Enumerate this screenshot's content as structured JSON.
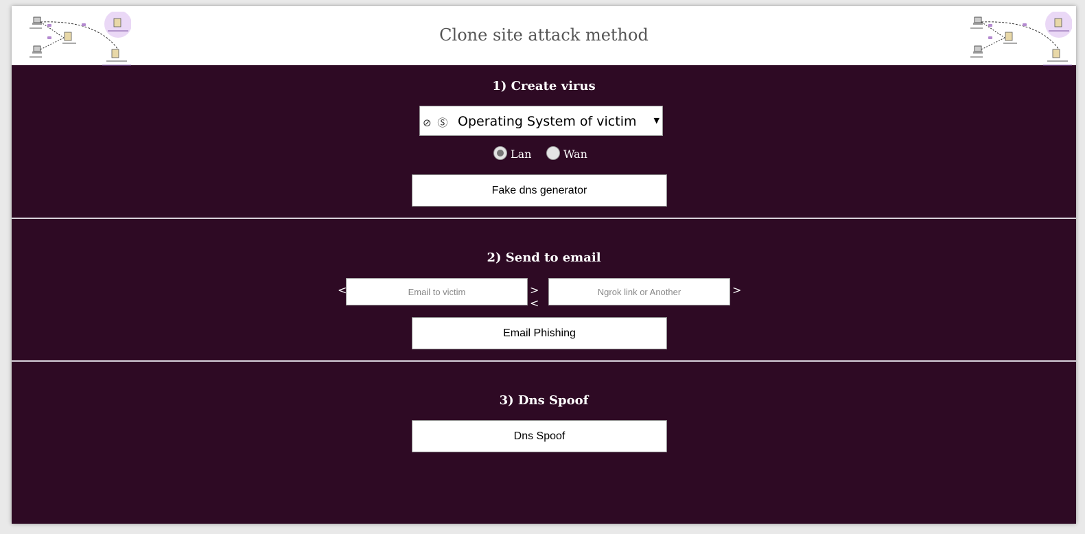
{
  "header": {
    "title": "Clone site attack method"
  },
  "section1": {
    "title": "1) Create virus",
    "os_select": {
      "icons": "⊘ Ⓢ",
      "value": "Operating System of victim"
    },
    "radios": [
      {
        "label": "Lan",
        "checked": true
      },
      {
        "label": "Wan",
        "checked": false
      }
    ],
    "button": "Fake dns generator"
  },
  "section2": {
    "title": "2) Send to email",
    "email_placeholder": "Email to victim",
    "link_placeholder": "Ngrok link or Another",
    "brackets": [
      "<",
      "><",
      ">"
    ],
    "button": "Email Phishing"
  },
  "section3": {
    "title": "3) Dns Spoof",
    "button": "Dns Spoof"
  },
  "colors": {
    "background": "#2e0a24",
    "header": "#ffffff"
  }
}
